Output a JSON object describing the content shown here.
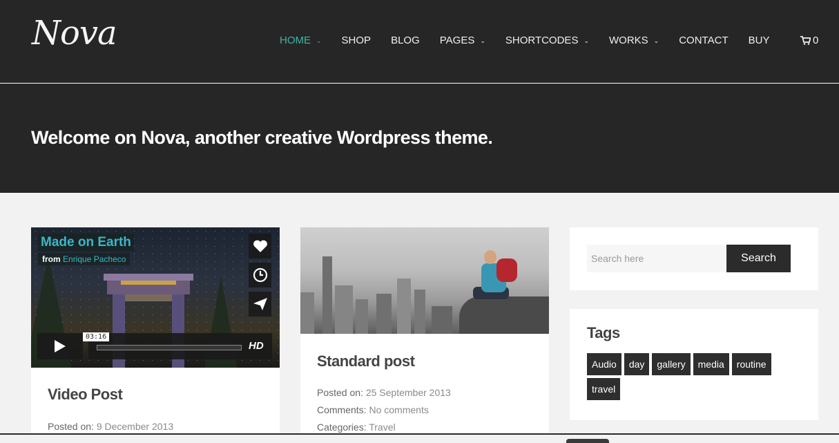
{
  "header": {
    "logo": "Nova",
    "nav": [
      {
        "label": "HOME",
        "active": true,
        "dropdown": true
      },
      {
        "label": "SHOP",
        "active": false,
        "dropdown": false
      },
      {
        "label": "BLOG",
        "active": false,
        "dropdown": false
      },
      {
        "label": "PAGES",
        "active": false,
        "dropdown": true
      },
      {
        "label": "SHORTCODES",
        "active": false,
        "dropdown": true
      },
      {
        "label": "WORKS",
        "active": false,
        "dropdown": true
      },
      {
        "label": "CONTACT",
        "active": false,
        "dropdown": false
      },
      {
        "label": "BUY",
        "active": false,
        "dropdown": false
      }
    ],
    "cart_count": "0"
  },
  "hero": {
    "title": "Welcome on Nova, another creative Wordpress theme."
  },
  "posts": [
    {
      "video": {
        "title": "Made on Earth",
        "from_label": "from",
        "author": "Enrique Pacheco",
        "time": "03:16",
        "hd_label": "HD"
      },
      "title": "Video Post",
      "posted_on_label": "Posted on:",
      "posted_on": "9 December 2013"
    },
    {
      "title": "Standard post",
      "posted_on_label": "Posted on:",
      "posted_on": "25 September 2013",
      "comments_label": "Comments:",
      "comments": "No comments",
      "categories_label": "Categories:",
      "categories": "Travel"
    }
  ],
  "sidebar": {
    "search": {
      "placeholder": "Search here",
      "button_label": "Search"
    },
    "tags": {
      "title": "Tags",
      "items": [
        "Audio",
        "day",
        "gallery",
        "media",
        "routine",
        "travel"
      ]
    }
  },
  "colors": {
    "accent": "#3bb7a4",
    "dark": "#262626",
    "background": "#f2f2f2"
  }
}
